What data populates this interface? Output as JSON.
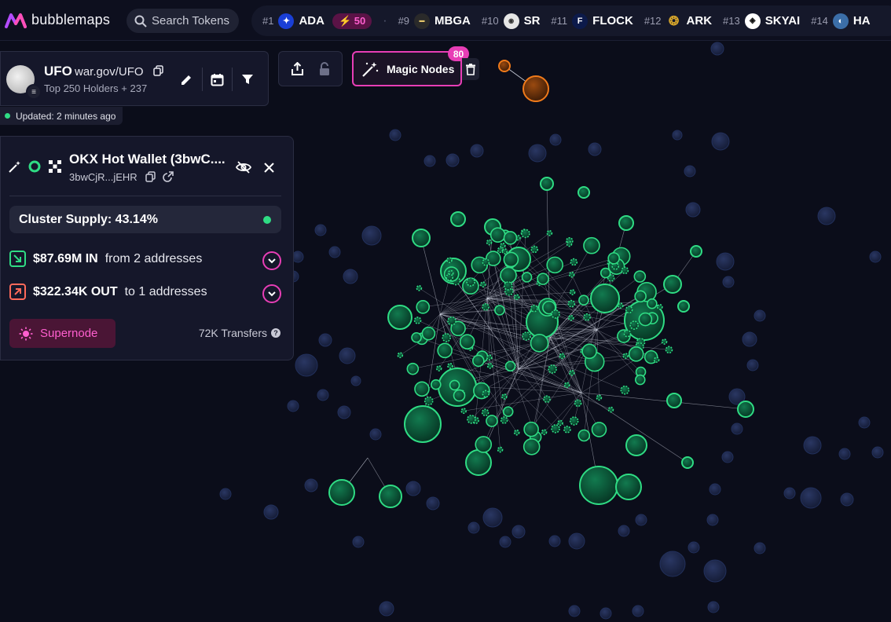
{
  "app": {
    "brand": "bubblemaps"
  },
  "search": {
    "label": "Search Tokens"
  },
  "ticker": [
    {
      "rank": "#1",
      "symbol": "ADA",
      "icon": "ada-icon",
      "color": "#1a3fd6",
      "boost": "50"
    },
    {
      "rank": "#9",
      "symbol": "MBGA",
      "icon": "mbga-icon",
      "color": "#222222"
    },
    {
      "rank": "#10",
      "symbol": "SR",
      "icon": "sr-icon",
      "color": "#e6e6e6"
    },
    {
      "rank": "#11",
      "symbol": "FLOCK",
      "icon": "flock-icon",
      "color": "#0c1a4a"
    },
    {
      "rank": "#12",
      "symbol": "ARK",
      "icon": "ark-icon",
      "color": "#d4a42b"
    },
    {
      "rank": "#13",
      "symbol": "SKYAI",
      "icon": "skyai-icon",
      "color": "#ffffff"
    },
    {
      "rank": "#14",
      "symbol": "HA",
      "icon": "ha-icon",
      "color": "#3b6ea8"
    }
  ],
  "token": {
    "name": "UFO",
    "site": "war.gov/UFO",
    "subtitle": "Top 250 Holders + 237",
    "updated": "Updated: 2 minutes ago"
  },
  "magic_nodes": {
    "label": "Magic Nodes",
    "count": "80"
  },
  "wallet": {
    "name": "OKX Hot Wallet (3bwC....",
    "address": "3bwCjR...jEHR",
    "cluster_supply": "Cluster Supply: 43.14%",
    "inflow_amount": "$87.69M IN",
    "inflow_text": "from 2 addresses",
    "outflow_amount": "$322.34K OUT",
    "outflow_text": "to 1 addresses",
    "supernode": "Supernode",
    "transfers": "72K Transfers"
  },
  "colors": {
    "accent": "#e83eb6",
    "cluster": "#2fdc84",
    "bubble": "#1c2748",
    "highlight": "#f07a1a"
  }
}
